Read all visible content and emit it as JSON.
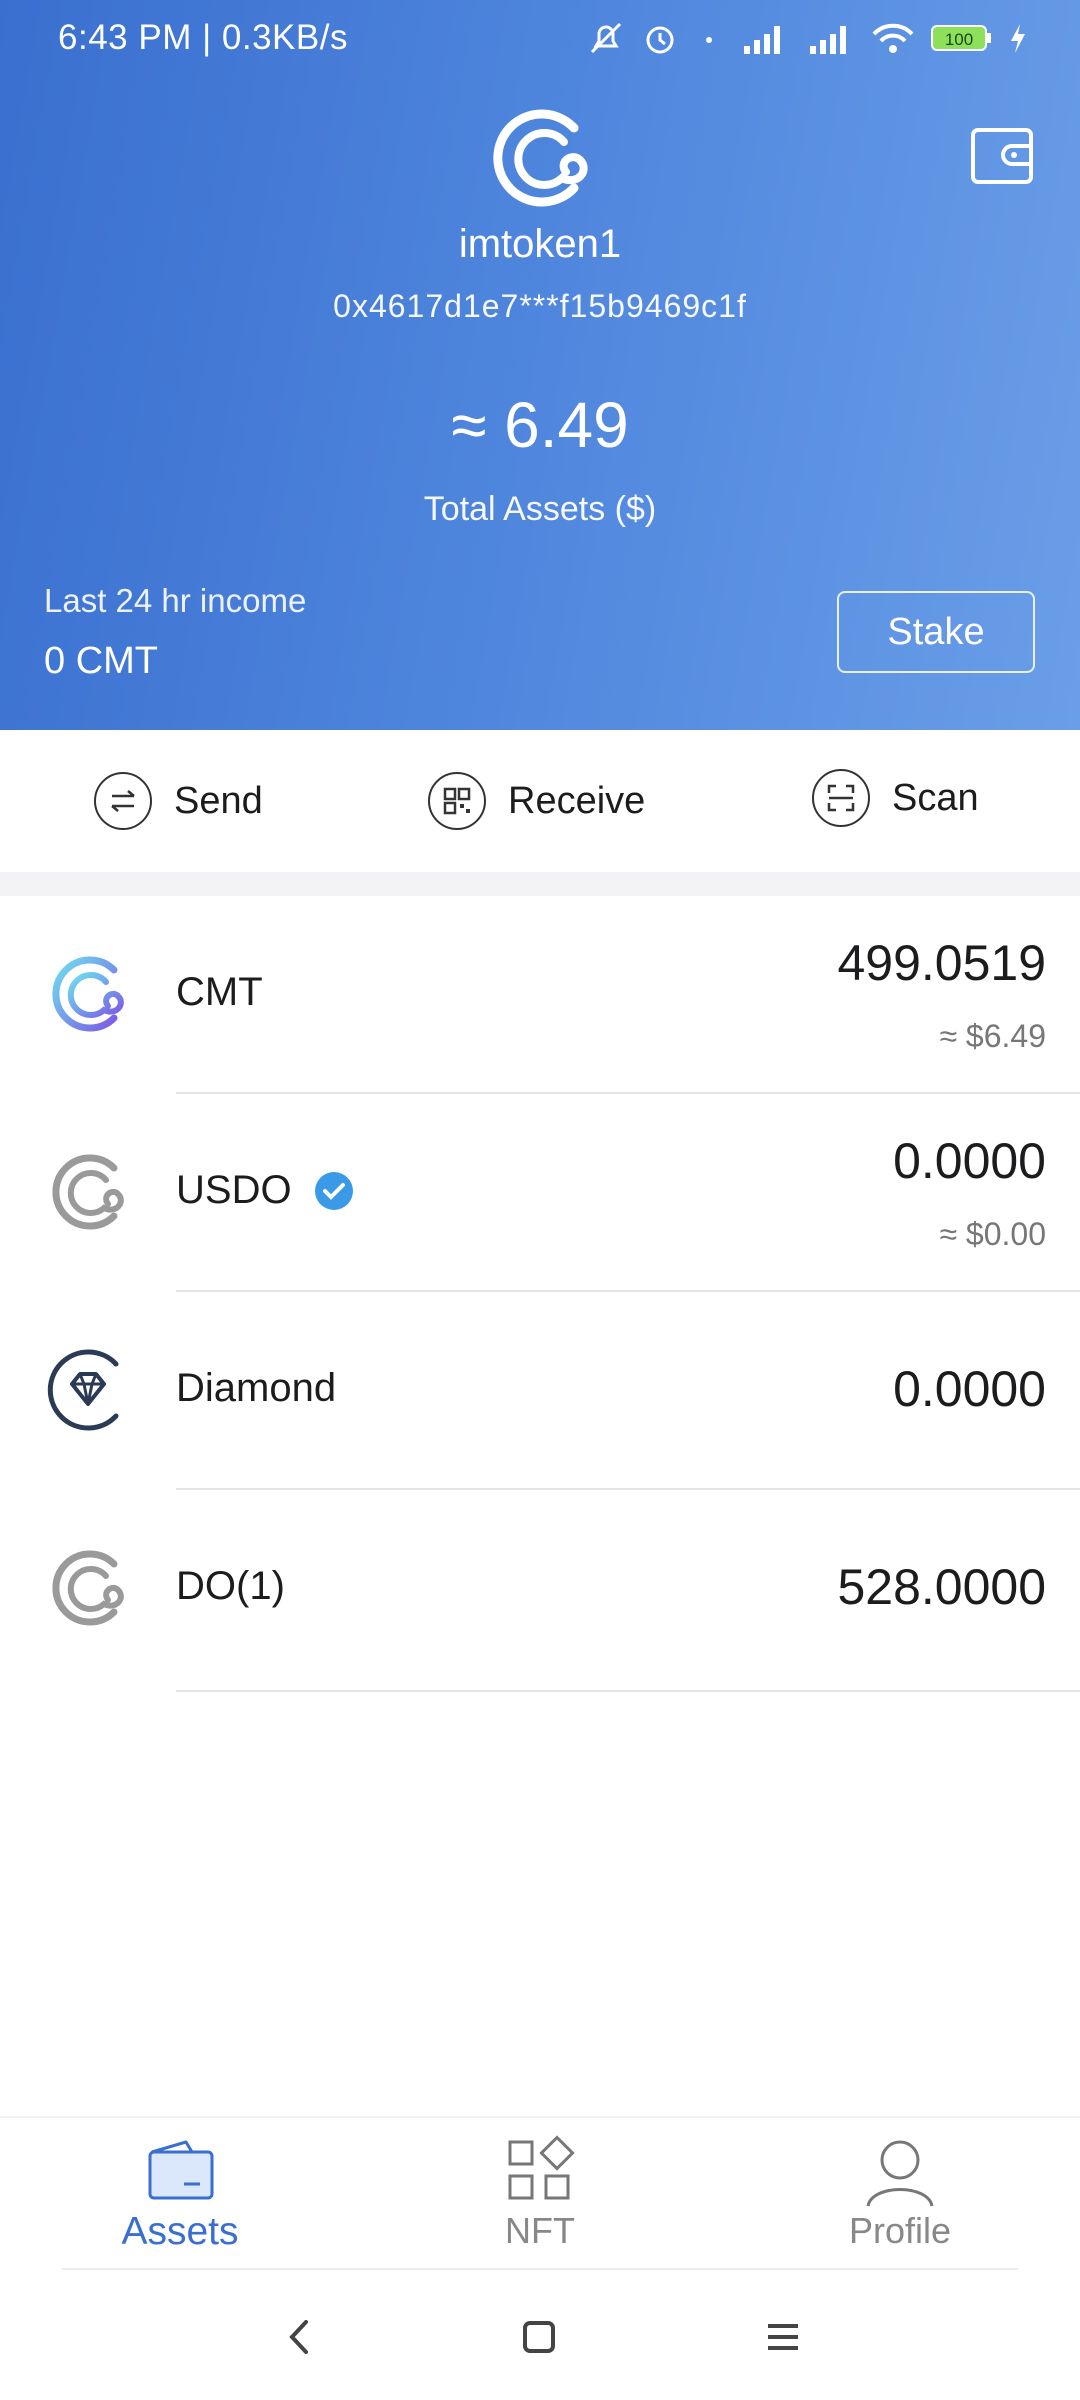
{
  "status_bar": {
    "time_speed": "6:43 PM | 0.3KB/s",
    "battery": "100",
    "icons": [
      "mute-icon",
      "alarm-icon",
      "dot-icon",
      "hd-signal-icon",
      "hd-signal-icon",
      "wifi-icon",
      "battery-icon",
      "charging-icon"
    ]
  },
  "header": {
    "wallet_name": "imtoken1",
    "address": "0x4617d1e7***f15b9469c1f",
    "total_value": "≈ 6.49",
    "total_label": "Total Assets ($)",
    "income_label": "Last 24 hr income",
    "income_value": "0 CMT",
    "stake_label": "Stake",
    "colors": {
      "gradient_start": "#3a6fcf",
      "gradient_end": "#6a9ee8"
    }
  },
  "actions": [
    {
      "label": "Send",
      "icon": "transfer-icon"
    },
    {
      "label": "Receive",
      "icon": "qr-code-icon"
    },
    {
      "label": "Scan",
      "icon": "scan-icon"
    }
  ],
  "assets": [
    {
      "symbol": "CMT",
      "amount": "499.0519",
      "fiat": "≈ $6.49",
      "icon": "cmt-coin-icon"
    },
    {
      "symbol": "USDO",
      "amount": "0.0000",
      "fiat": "≈ $0.00",
      "icon": "usdo-coin-icon",
      "verified": true
    },
    {
      "symbol": "Diamond",
      "amount": "0.0000",
      "icon": "diamond-coin-icon"
    },
    {
      "symbol": "DO(1)",
      "amount": "528.0000",
      "icon": "do-coin-icon"
    }
  ],
  "tabs": [
    {
      "label": "Assets",
      "icon": "wallet-icon",
      "active": true
    },
    {
      "label": "NFT",
      "icon": "nft-grid-icon",
      "active": false
    },
    {
      "label": "Profile",
      "icon": "person-icon",
      "active": false
    }
  ],
  "colors": {
    "accent": "#3a6fcf",
    "verified": "#3b9ae8",
    "text_muted": "#777777"
  }
}
